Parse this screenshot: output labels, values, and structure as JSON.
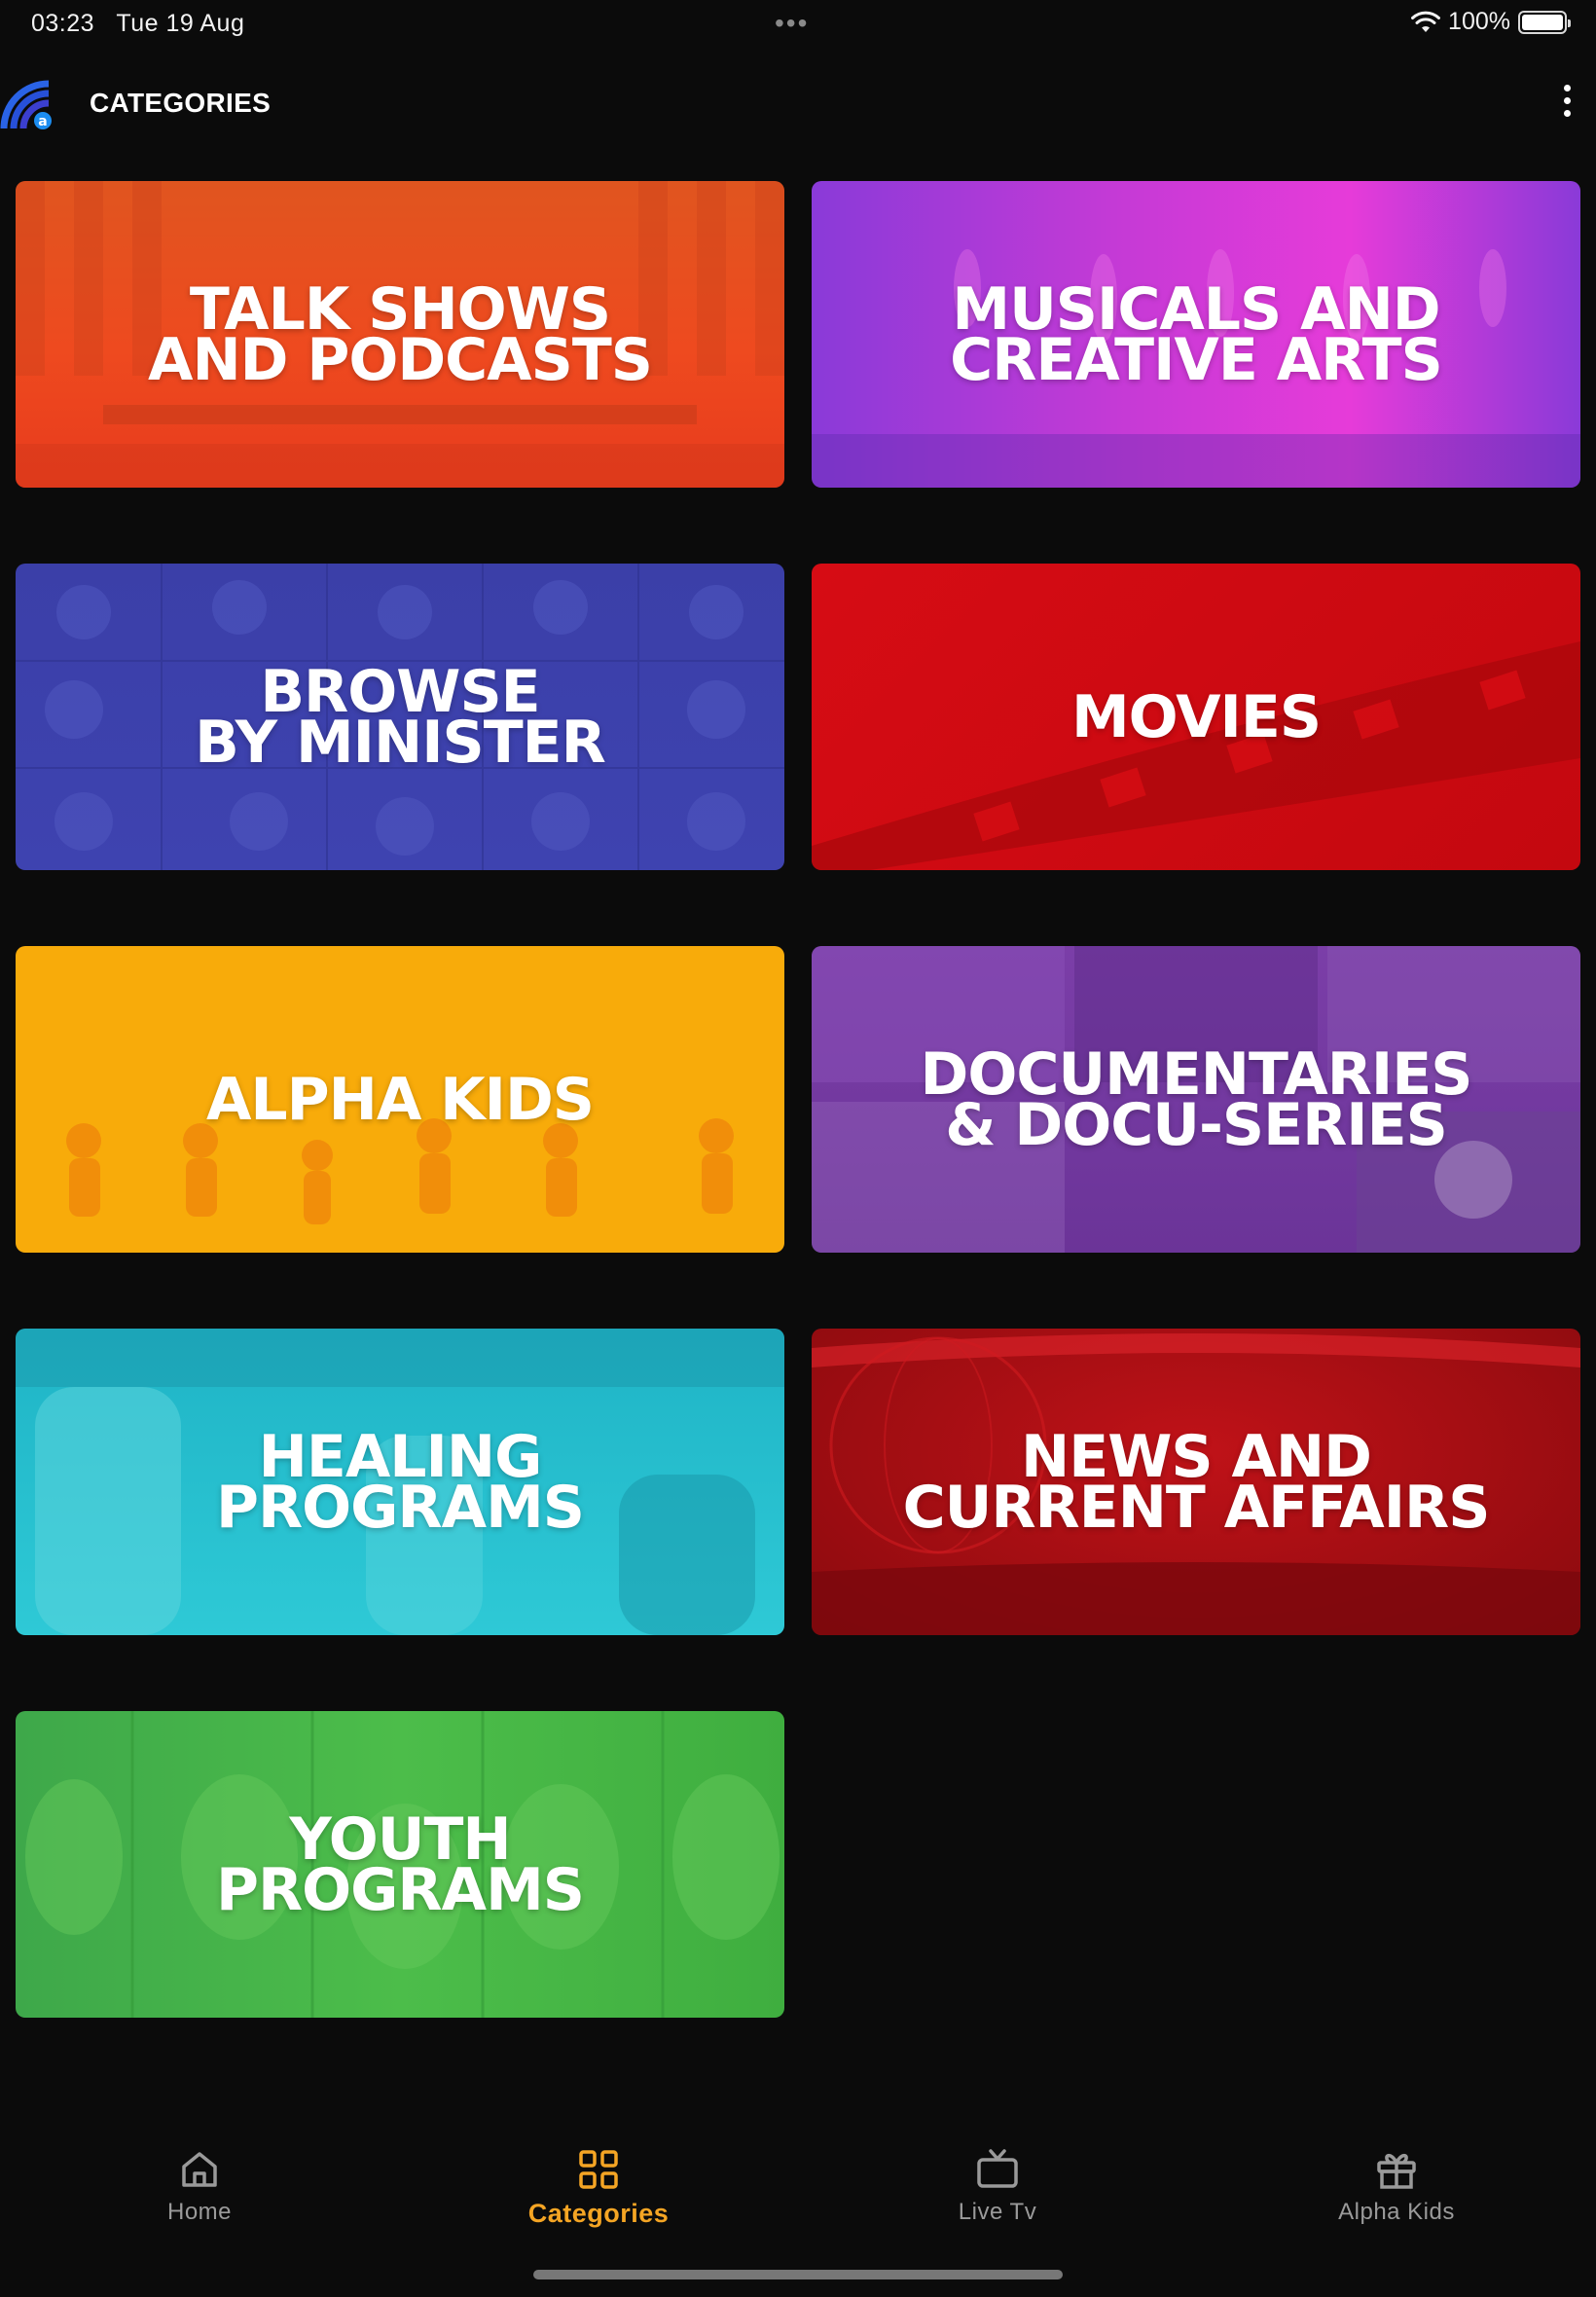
{
  "status_bar": {
    "time": "03:23",
    "date": "Tue 19 Aug",
    "dots": "•••",
    "battery": "100%"
  },
  "app_bar": {
    "title": "CATEGORIES"
  },
  "categories": [
    {
      "label": "TALK SHOWS\nAND PODCASTS"
    },
    {
      "label": "MUSICALS AND\nCREATIVE ARTS"
    },
    {
      "label": "BROWSE\nBY MINISTER"
    },
    {
      "label": "MOVIES"
    },
    {
      "label": "ALPHA KIDS"
    },
    {
      "label": "DOCUMENTARIES\n& DOCU-SERIES"
    },
    {
      "label": "HEALING\nPROGRAMS"
    },
    {
      "label": "NEWS AND\nCURRENT AFFAIRS"
    },
    {
      "label": "YOUTH\nPROGRAMS"
    }
  ],
  "bottom_nav": {
    "items": [
      {
        "label": "Home",
        "icon": "home-icon"
      },
      {
        "label": "Categories",
        "icon": "grid-icon",
        "active": true
      },
      {
        "label": "Live Tv",
        "icon": "tv-icon"
      },
      {
        "label": "Alpha Kids",
        "icon": "gift-icon"
      }
    ]
  },
  "colors": {
    "background": "#0b0b0b",
    "accent": "#f5a524",
    "inactive_nav": "#9a9a9a"
  }
}
